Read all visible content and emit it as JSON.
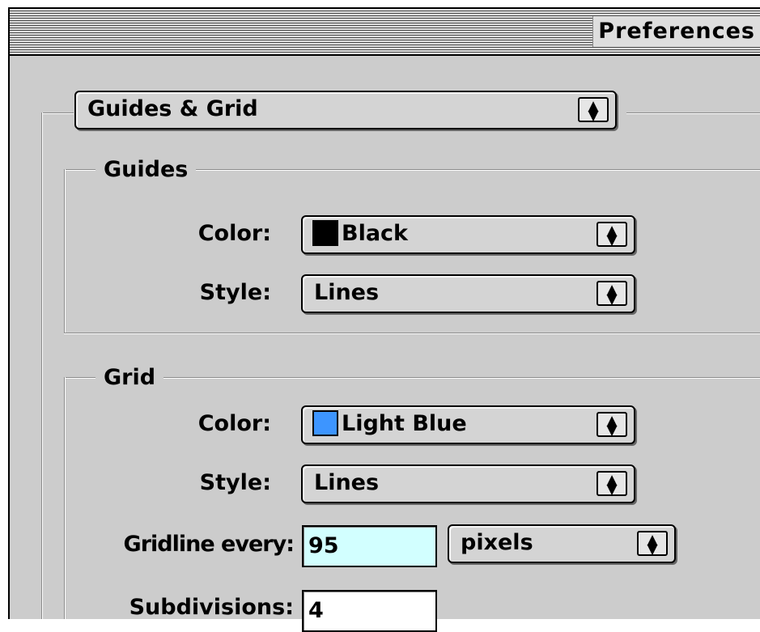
{
  "window": {
    "title": "Preferences"
  },
  "section_menu": {
    "value": "Guides & Grid"
  },
  "guides": {
    "title": "Guides",
    "color_label": "Color:",
    "color_value": "Black",
    "color_swatch": "#000000",
    "style_label": "Style:",
    "style_value": "Lines"
  },
  "grid": {
    "title": "Grid",
    "color_label": "Color:",
    "color_value": "Light Blue",
    "color_swatch": "#3d95ff",
    "style_label": "Style:",
    "style_value": "Lines",
    "gridline_label": "Gridline every:",
    "gridline_value": "95",
    "gridline_unit": "pixels",
    "subdivisions_label": "Subdivisions:",
    "subdivisions_value": "4"
  },
  "icons": {
    "popup_arrows": "up-down-arrows-icon"
  }
}
